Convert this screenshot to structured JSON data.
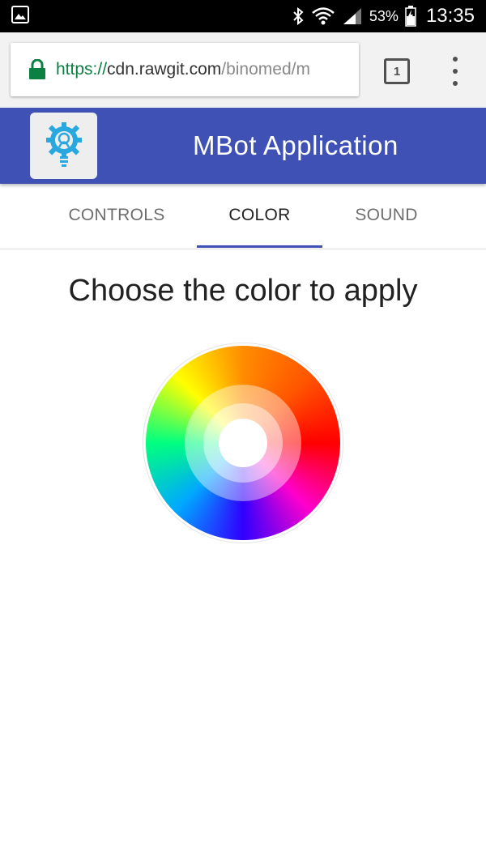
{
  "status_bar": {
    "battery_percent": "53%",
    "time": "13:35"
  },
  "browser": {
    "url_scheme": "https://",
    "url_host": "cdn.rawgit.com",
    "url_path": "/binomed/m",
    "tab_count": "1"
  },
  "app_bar": {
    "title": "MBot Application"
  },
  "tabs": [
    {
      "label": "CONTROLS",
      "active": false
    },
    {
      "label": "COLOR",
      "active": true
    },
    {
      "label": "SOUND",
      "active": false
    }
  ],
  "main": {
    "heading": "Choose the color to apply"
  },
  "colors": {
    "app_bar": "#3f51b5",
    "tab_indicator": "#3f51b5",
    "url_scheme": "#0b8043",
    "logo_icon": "#29a8e0"
  },
  "icons": {
    "status_left": "gallery-icon",
    "status_right": [
      "bluetooth-icon",
      "wifi-icon",
      "signal-icon",
      "battery-icon"
    ],
    "url": "lock-icon",
    "logo": "lightbulb-gear-icon",
    "menu": "more-vert-icon"
  }
}
